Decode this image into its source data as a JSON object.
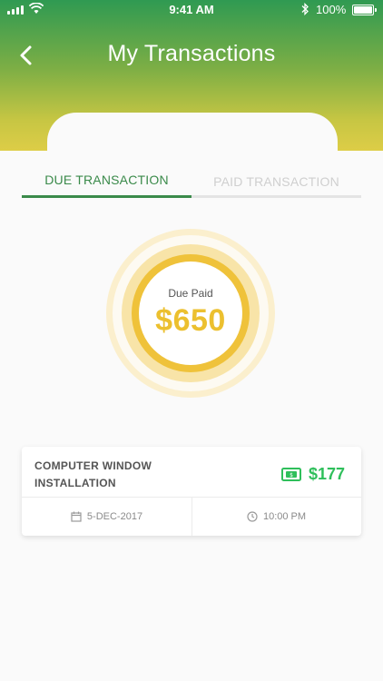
{
  "status_bar": {
    "time": "9:41 AM",
    "battery": "100%"
  },
  "header": {
    "title": "My Transactions",
    "back_icon": "chevron-left-icon"
  },
  "tabs": [
    {
      "label": "DUE TRANSACTION",
      "active": true
    },
    {
      "label": "PAID TRANSACTION",
      "active": false
    }
  ],
  "summary": {
    "label": "Due Paid",
    "amount": "$650"
  },
  "transactions": [
    {
      "title_line1": "COMPUTER WINDOW",
      "title_line2": "INSTALLATION",
      "amount": "$177",
      "date": "5-DEC-2017",
      "time": "10:00 PM",
      "icons": {
        "amount": "money-icon",
        "date": "calendar-icon",
        "time": "clock-icon"
      }
    }
  ],
  "colors": {
    "header_gradient": [
      "#2f9a52",
      "#ddcd47"
    ],
    "active_tab": "#3a8a4a",
    "inactive_tab": "#cfcfcf",
    "gold": "#ecc02f",
    "price_green": "#2fbf5b"
  }
}
